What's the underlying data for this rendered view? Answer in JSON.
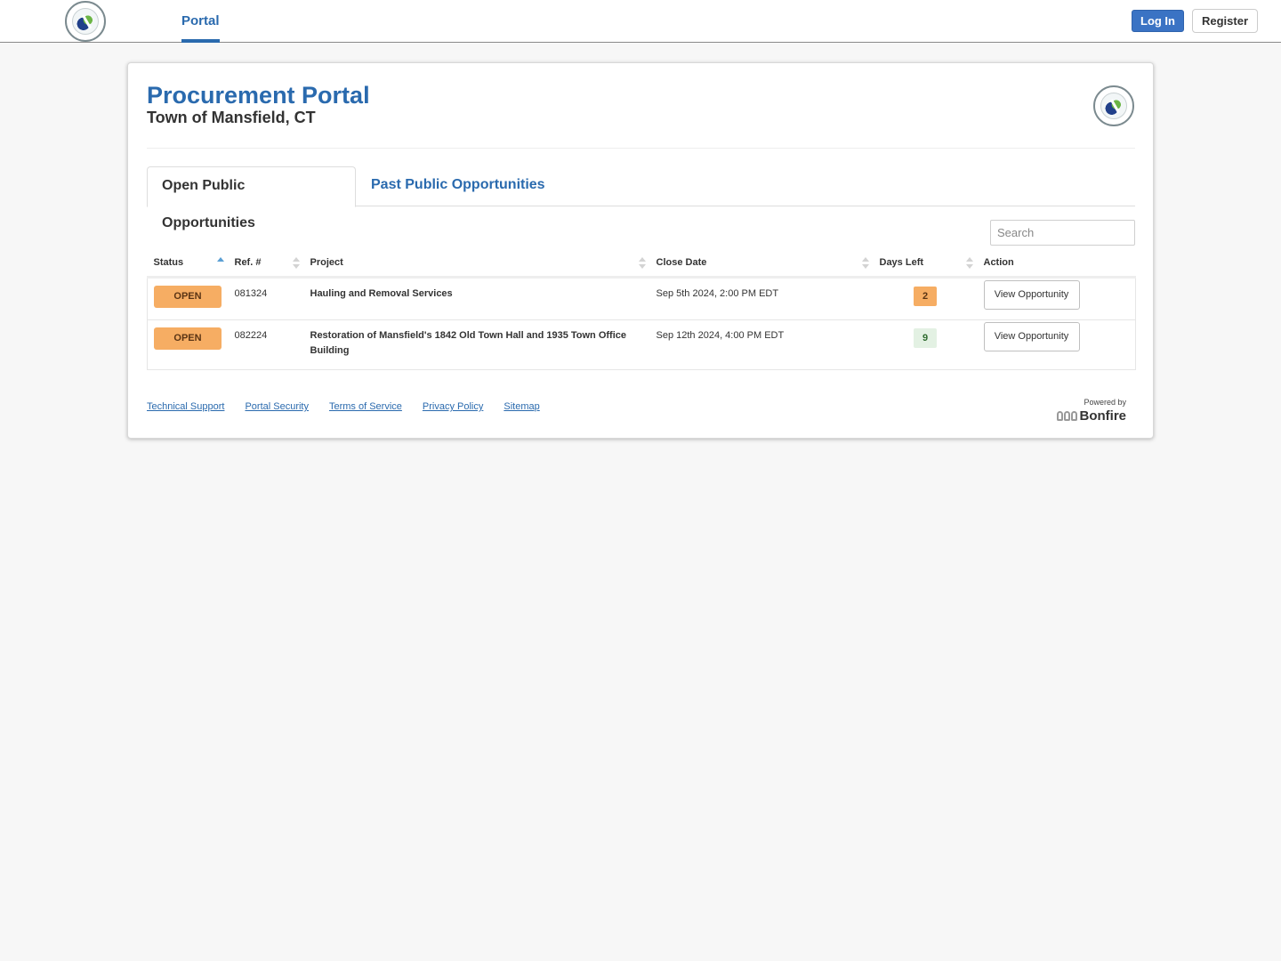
{
  "topbar": {
    "logo_alt": "Town of Mansfield seal",
    "nav_portal": "Portal",
    "login_label": "Log In",
    "register_label": "Register"
  },
  "header": {
    "title": "Procurement Portal",
    "subtitle": "Town of Mansfield, CT"
  },
  "tabs": [
    {
      "label": "Open Public Opportunities",
      "active": true
    },
    {
      "label": "Past Public Opportunities",
      "active": false
    }
  ],
  "search": {
    "placeholder": "Search",
    "value": ""
  },
  "table": {
    "columns": [
      {
        "label": "Status",
        "sort": "asc"
      },
      {
        "label": "Ref. #",
        "sort": "none"
      },
      {
        "label": "Project",
        "sort": "none"
      },
      {
        "label": "Close Date",
        "sort": "none"
      },
      {
        "label": "Days Left",
        "sort": "none"
      },
      {
        "label": "Action",
        "sort": null
      }
    ],
    "rows": [
      {
        "status": "OPEN",
        "ref": "081324",
        "project": "Hauling and Removal Services",
        "close_date": "Sep 5th 2024, 2:00 PM EDT",
        "days_left": "2",
        "days_level": "urgent",
        "action": "View Opportunity"
      },
      {
        "status": "OPEN",
        "ref": "082224",
        "project": "Restoration of Mansfield's 1842 Old Town Hall and 1935 Town Office Building",
        "close_date": "Sep 12th 2024, 4:00 PM EDT",
        "days_left": "9",
        "days_level": "ok",
        "action": "View Opportunity"
      }
    ]
  },
  "footer": {
    "links": [
      "Technical Support",
      "Portal Security",
      "Terms of Service",
      "Privacy Policy",
      "Sitemap"
    ],
    "powered_by": "Powered by",
    "brand": "Bonfire"
  },
  "colors": {
    "brand_blue": "#2a6aae",
    "login_blue": "#3a73c4",
    "status_open": "#f6ad63",
    "days_ok": "#e3f1e3"
  }
}
